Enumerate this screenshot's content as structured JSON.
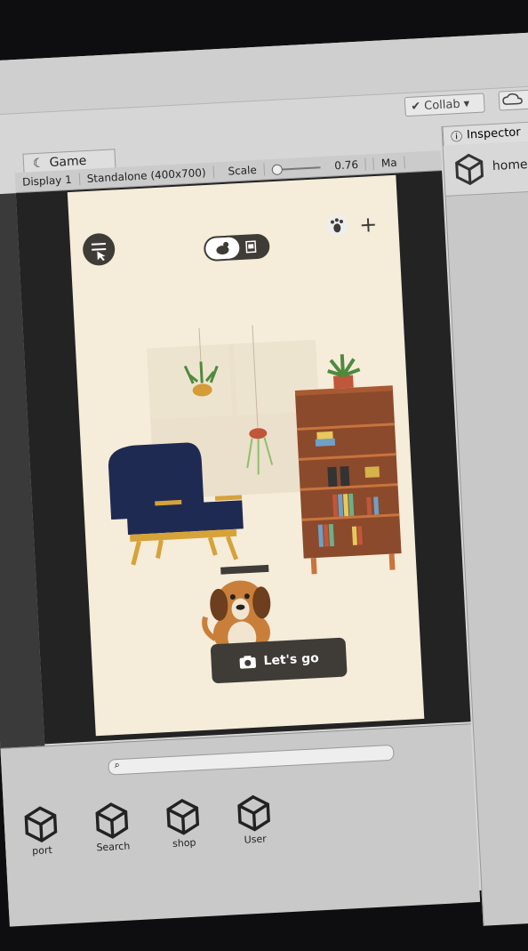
{
  "toolbar": {
    "collab_label": "Collab ▾"
  },
  "game_panel": {
    "tab_label": "Game",
    "display_select": "Display 1",
    "resolution_select": "Standalone (400x700)",
    "scale_label": "Scale",
    "scale_value": "0.76",
    "maximize_label": "Ma"
  },
  "game_view": {
    "lets_go_label": "Let's go"
  },
  "inspector": {
    "tab_label": "Inspector",
    "object_name": "homepa"
  },
  "project": {
    "assets": [
      {
        "label": "port"
      },
      {
        "label": "Search"
      },
      {
        "label": "shop"
      },
      {
        "label": "User"
      }
    ]
  },
  "colors": {
    "editor_bg": "#d6d6d6",
    "game_canvas_bg": "#f5ecd9",
    "dark_ui": "#3f3b37",
    "bookshelf": "#8b4a2b",
    "chair": "#1f2a52"
  }
}
